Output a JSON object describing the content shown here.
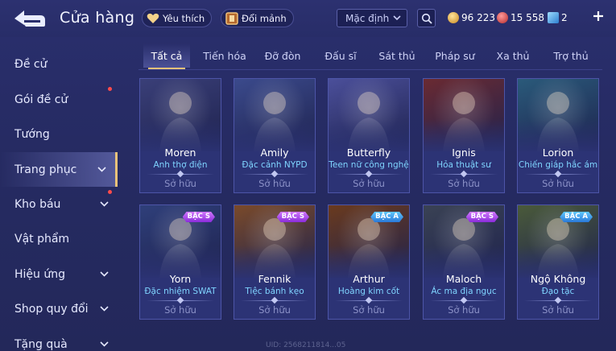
{
  "header": {
    "title": "Cửa hàng",
    "wishlist_label": "Yêu thích",
    "exchange_label": "Đổi mảnh",
    "sort_value": "Mặc định",
    "currencies": [
      {
        "name": "gold-coin",
        "value": "96 223",
        "color": "#e8b545"
      },
      {
        "name": "red-gem",
        "value": "15 558",
        "color": "#e04848"
      },
      {
        "name": "voucher",
        "value": "2",
        "color": "#5ab4ff"
      }
    ]
  },
  "sidebar": {
    "items": [
      {
        "label": "Đề cử",
        "dot": false,
        "chevron": false,
        "active": false
      },
      {
        "label": "Gói đề cử",
        "dot": true,
        "chevron": false,
        "active": false
      },
      {
        "label": "Tướng",
        "dot": false,
        "chevron": false,
        "active": false
      },
      {
        "label": "Trang phục",
        "dot": false,
        "chevron": true,
        "active": true
      },
      {
        "label": "Kho báu",
        "dot": true,
        "chevron": true,
        "active": false
      },
      {
        "label": "Vật phẩm",
        "dot": false,
        "chevron": false,
        "active": false
      },
      {
        "label": "Hiệu ứng",
        "dot": false,
        "chevron": true,
        "active": false
      },
      {
        "label": "Shop quy đổi",
        "dot": false,
        "chevron": true,
        "active": false
      },
      {
        "label": "Tặng quà",
        "dot": false,
        "chevron": true,
        "active": false
      }
    ]
  },
  "tabs": [
    {
      "label": "Tất cả",
      "active": true
    },
    {
      "label": "Tiến hóa",
      "active": false
    },
    {
      "label": "Đỡ đòn",
      "active": false
    },
    {
      "label": "Đấu sĩ",
      "active": false
    },
    {
      "label": "Sát thủ",
      "active": false
    },
    {
      "label": "Pháp sư",
      "active": false
    },
    {
      "label": "Xa thủ",
      "active": false
    },
    {
      "label": "Trợ thủ",
      "active": false
    }
  ],
  "cards": [
    {
      "name": "Moren",
      "skin": "Anh thợ điện",
      "status": "Sở hữu",
      "badge": "",
      "tint": "#3a3f78"
    },
    {
      "name": "Amily",
      "skin": "Đặc cảnh NYPD",
      "status": "Sở hữu",
      "badge": "",
      "tint": "#3b4a8c"
    },
    {
      "name": "Butterfly",
      "skin": "Teen nữ công nghệ",
      "status": "Sở hữu",
      "badge": "",
      "tint": "#4b4f9a"
    },
    {
      "name": "Ignis",
      "skin": "Hỏa thuật sư",
      "status": "Sở hữu",
      "badge": "",
      "tint": "#6a2a32"
    },
    {
      "name": "Lorion",
      "skin": "Chiến giáp hắc ám",
      "status": "Sở hữu",
      "badge": "",
      "tint": "#2a5a7a"
    },
    {
      "name": "Yorn",
      "skin": "Đặc nhiệm SWAT",
      "status": "Sở hữu",
      "badge": "BẬC S",
      "tint": "#2f3f7a"
    },
    {
      "name": "Fennik",
      "skin": "Tiệc bánh kẹo",
      "status": "Sở hữu",
      "badge": "BẬC S",
      "tint": "#7a4a2a"
    },
    {
      "name": "Arthur",
      "skin": "Hoàng kim cốt",
      "status": "Sở hữu",
      "badge": "BẬC A",
      "tint": "#6a3a1e"
    },
    {
      "name": "Maloch",
      "skin": "Ác ma địa ngục",
      "status": "Sở hữu",
      "badge": "BẬC S",
      "tint": "#3a4254"
    },
    {
      "name": "Ngộ Không",
      "skin": "Đạo tặc",
      "status": "Sở hữu",
      "badge": "BẬC A",
      "tint": "#4a5a3a"
    }
  ],
  "watermark": "UID: 2568211814...05"
}
